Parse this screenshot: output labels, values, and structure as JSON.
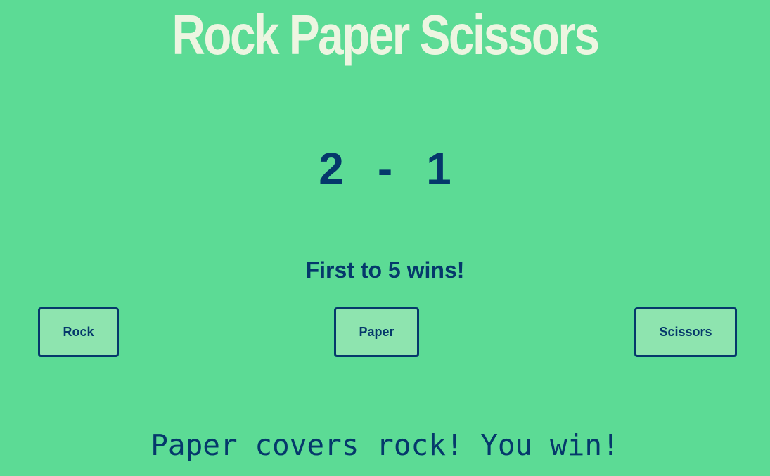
{
  "header": {
    "title": "Rock Paper Scissors"
  },
  "score": {
    "player": "2",
    "separator": "-",
    "computer": "1"
  },
  "rule_text": "First to 5 wins!",
  "choices": {
    "rock_label": "Rock",
    "paper_label": "Paper",
    "scissors_label": "Scissors"
  },
  "result_text": "Paper covers rock! You win!",
  "colors": {
    "background": "#5cdb95",
    "title": "#edf5e1",
    "text": "#05386b",
    "button_bg": "#8ee4af"
  }
}
